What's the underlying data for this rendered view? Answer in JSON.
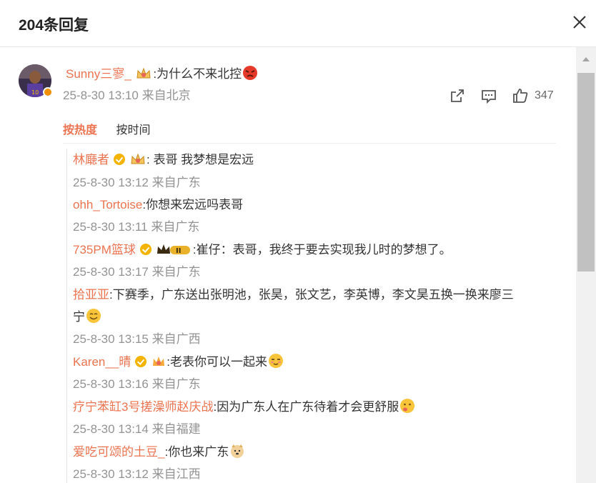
{
  "header": {
    "title": "204条回复"
  },
  "main_comment": {
    "username": "Sunny三寥_",
    "text": ":为什么不来北控",
    "timestamp": "25-8-30 13:10",
    "location": "来自北京",
    "likes": "347",
    "icons": [
      "crown-badge-icon",
      "angry-face-emoji"
    ]
  },
  "sort": {
    "hot": "按热度",
    "time": "按时间"
  },
  "replies": [
    {
      "username": "林廰者",
      "text": ":  表哥 我梦想是宏远",
      "timestamp": "25-8-30 13:12",
      "location": "来自广东"
    },
    {
      "username": "ohh_Tortoise",
      "text": ":你想来宏远吗表哥",
      "timestamp": "25-8-30 13:11",
      "location": "来自广东"
    },
    {
      "username": "735PM篮球",
      "level": "II",
      "text": ":崔仔：表哥，我终于要去实现我儿时的梦想了。",
      "timestamp": "25-8-30 13:17",
      "location": "来自广东"
    },
    {
      "username": "拾亚亚",
      "text": ":下赛季，广东送出张明池，张昊，张文艺，李英博，李文昊五换一换来廖三",
      "text2": "宁",
      "timestamp": "25-8-30 13:15",
      "location": "来自广西"
    },
    {
      "username": "Karen__晴",
      "text": ":老表你可以一起来",
      "timestamp": "25-8-30 13:16",
      "location": "来自广东"
    },
    {
      "username": "疗宁苯缸3号搓澡师赵庆战",
      "text": ":因为广东人在广东待着才会更舒服",
      "timestamp": "25-8-30 13:14",
      "location": "来自福建"
    },
    {
      "username": "爱吃可颂的土豆_",
      "text": ":你也来广东",
      "timestamp": "25-8-30 13:12",
      "location": "来自江西"
    }
  ]
}
